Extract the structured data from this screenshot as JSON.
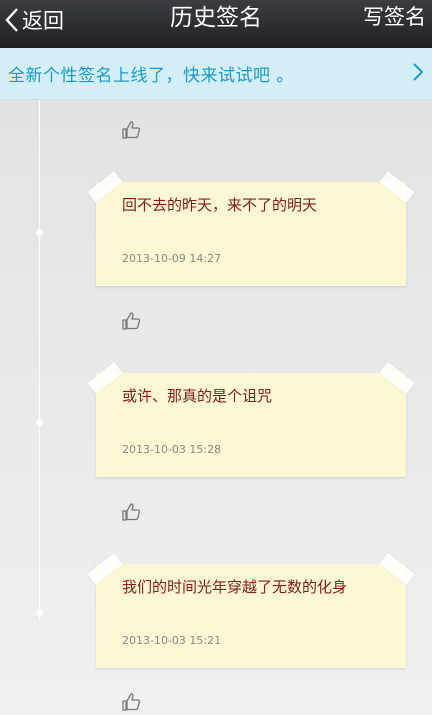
{
  "topbar": {
    "back_label": "返回",
    "title": "历史签名",
    "write_label": "写签名"
  },
  "banner": {
    "text": "全新个性签名上线了，快来试试吧 。"
  },
  "signatures": [
    {
      "text": "回不去的昨天，来不了的明天",
      "time": "2013-10-09 14:27"
    },
    {
      "text": "或许、那真的是个诅咒",
      "time": "2013-10-03 15:28"
    },
    {
      "text": "我们的时间光年穿越了无数的化身",
      "time": "2013-10-03 15:21"
    }
  ],
  "colors": {
    "topbar": "#2a2c30",
    "banner_bg": "#d3eef7",
    "banner_text": "#1a9ad0",
    "note_bg": "#fcf8d3",
    "note_text": "#8b1a1a"
  }
}
